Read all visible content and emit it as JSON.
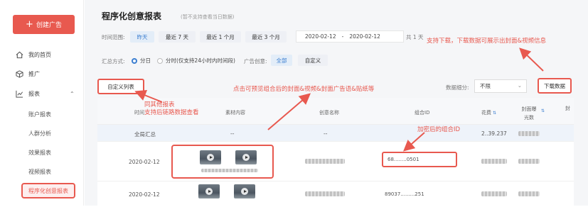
{
  "sidebar": {
    "create_label": "创建广告",
    "nav": [
      {
        "label": "我的首页",
        "icon": "home-icon"
      },
      {
        "label": "推广",
        "icon": "cube-icon"
      },
      {
        "label": "报表",
        "icon": "chart-icon"
      }
    ],
    "sub_items": [
      "账户报表",
      "人群分析",
      "效果报表",
      "视频报表"
    ],
    "active_item": "程序化创意报表"
  },
  "page": {
    "title": "程序化创意报表",
    "note": "(暂不支持查看当日数据)"
  },
  "filters": {
    "time_label": "时间范围:",
    "time_options": [
      "昨天",
      "最近 7 天",
      "最近 1 个月",
      "最近 3 个月"
    ],
    "date_start": "2020-02-12",
    "date_sep": "-",
    "date_end": "2020-02-12",
    "day_count": "共 1 天",
    "summary_label": "汇总方式:",
    "summary_options": [
      "分日",
      "分时(仅支持24小时内时间段)"
    ],
    "creative_label": "广告创意:",
    "creative_options": [
      "全部",
      "自定义"
    ]
  },
  "toolbar": {
    "custom_columns": "自定义列表",
    "group_label": "数据细分:",
    "group_value": "不限",
    "download": "下载数据"
  },
  "table": {
    "headers": [
      "时间",
      "素材内容",
      "创意名称",
      "组合ID",
      "花费",
      "封面曝光数",
      "封"
    ],
    "summary_row": {
      "time": "全局汇总",
      "material": "--",
      "name": "--",
      "cost": "2..39.237"
    },
    "rows": [
      {
        "time": "2020-02-12",
        "id": "68........0501"
      },
      {
        "time": "2020-02-12",
        "id": "89037.........251"
      }
    ]
  },
  "annotations": {
    "download_note": "支持下载，下载数据可展示出封面&视频信息",
    "preview_note": "点击可预览组合后的封面&视频&封面广告语&贴纸等",
    "same_note_1": "同其他报表",
    "same_note_2": "支持后链路数据查看",
    "id_note": "加密后的组合ID"
  },
  "colors": {
    "accent": "#e8594f",
    "blue": "#3b7ed0"
  }
}
